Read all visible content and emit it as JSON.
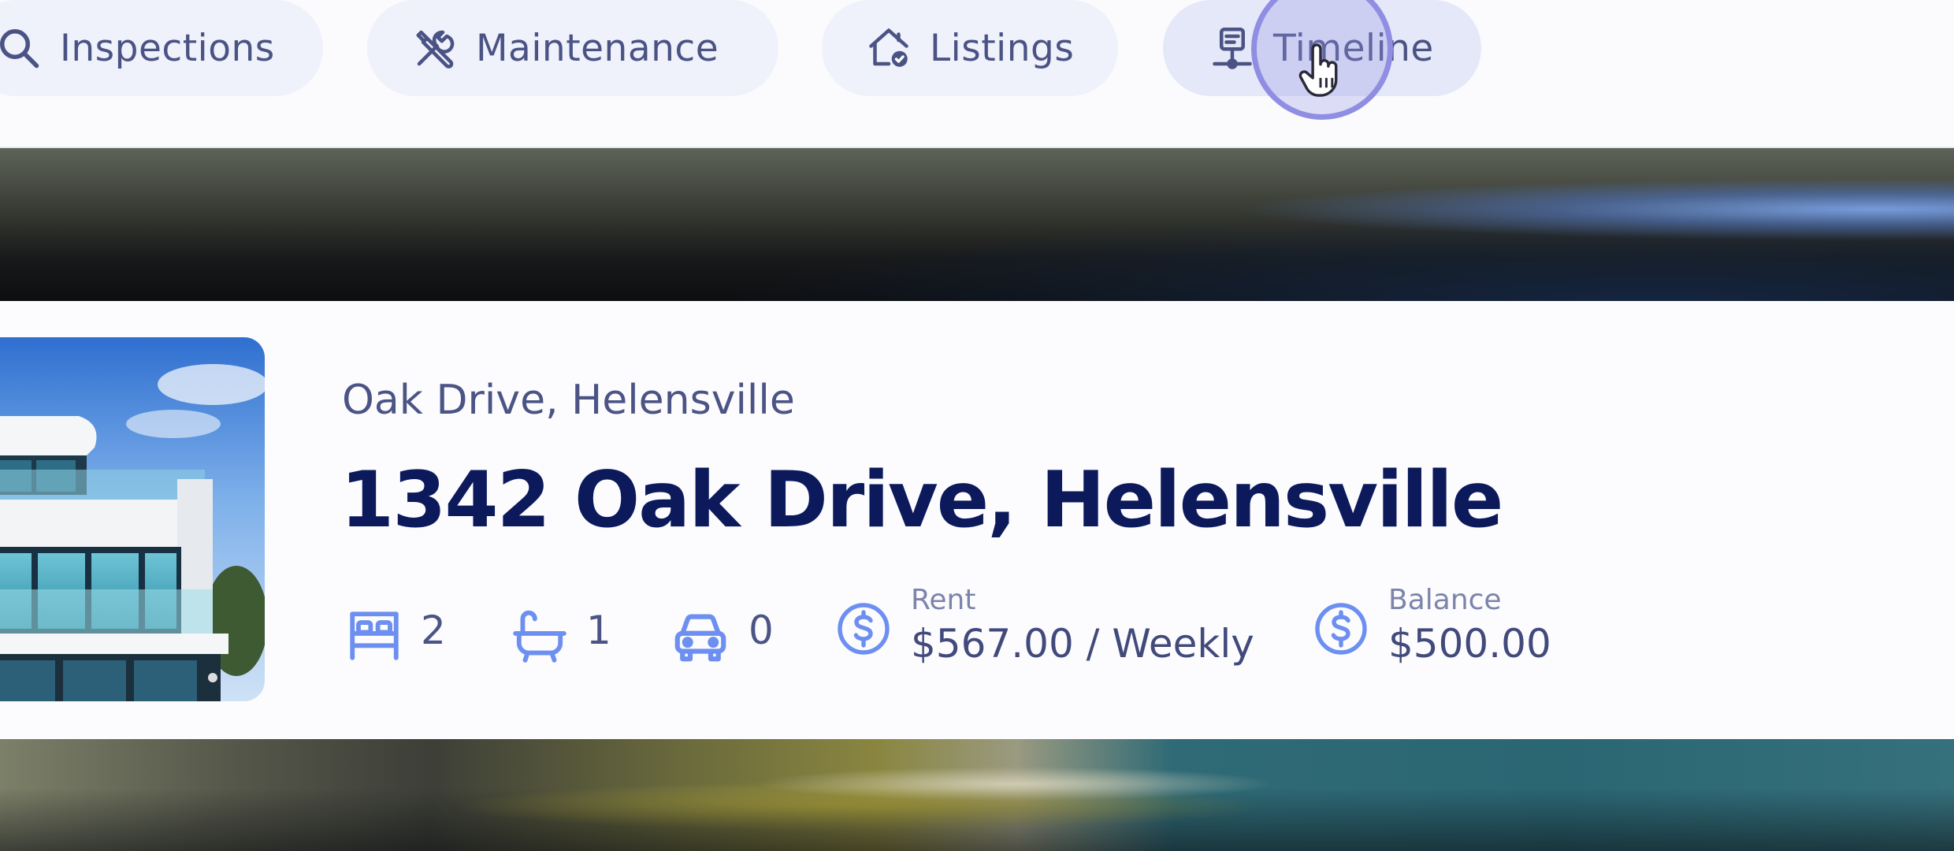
{
  "tabs": [
    {
      "id": "inspections",
      "label": "Inspections",
      "icon": "search-icon"
    },
    {
      "id": "maintenance",
      "label": "Maintenance",
      "icon": "tools-icon"
    },
    {
      "id": "listings",
      "label": "Listings",
      "icon": "house-check-icon"
    },
    {
      "id": "timeline",
      "label": "Timeline",
      "icon": "timeline-icon",
      "active": true
    }
  ],
  "property": {
    "suburb_line": "Oak Drive, Helensville",
    "address": "1342 Oak Drive, Helensville",
    "bedrooms": "2",
    "bathrooms": "1",
    "car_spaces": "0",
    "rent_label": "Rent",
    "rent_value": "$567.00 / Weekly",
    "balance_label": "Balance",
    "balance_value": "$500.00"
  },
  "colors": {
    "accent_icon": "#6d8ff0",
    "title_text": "#0c1a5c",
    "tab_background": "#eff1fb",
    "tab_text": "#4a5384",
    "cursor_ring": "#8f8ee2"
  }
}
